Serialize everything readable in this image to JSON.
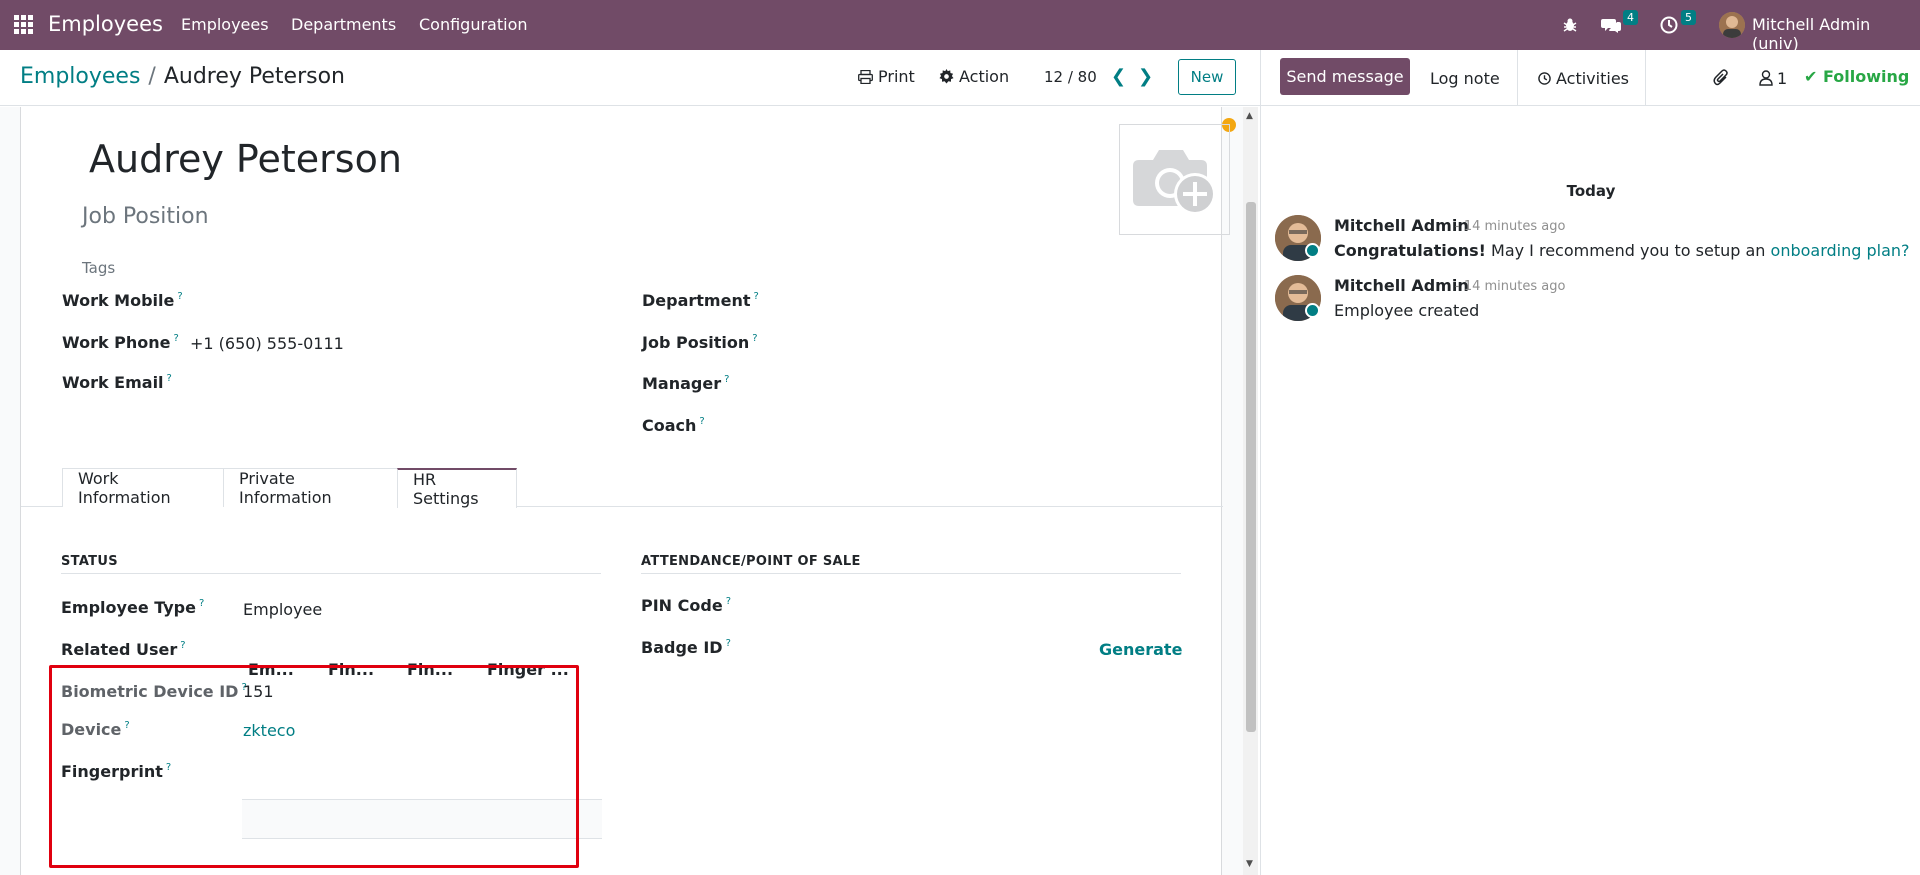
{
  "navbar": {
    "brand": "Employees",
    "menu": [
      "Employees",
      "Departments",
      "Configuration"
    ],
    "messages_count": "4",
    "activities_count": "5",
    "user": "Mitchell Admin (univ)"
  },
  "control_panel": {
    "breadcrumb_parent": "Employees",
    "breadcrumb_sep": "/",
    "breadcrumb_current": "Audrey Peterson",
    "print_label": "Print",
    "action_label": "Action",
    "pager": "12 / 80",
    "new_label": "New"
  },
  "form": {
    "name": "Audrey Peterson",
    "job_position_placeholder": "Job Position",
    "tags_placeholder": "Tags",
    "left_fields": [
      {
        "label": "Work Mobile",
        "value": ""
      },
      {
        "label": "Work Phone",
        "value": "+1 (650) 555-0111"
      },
      {
        "label": "Work Email",
        "value": ""
      }
    ],
    "right_fields": [
      {
        "label": "Department",
        "value": ""
      },
      {
        "label": "Job Position",
        "value": ""
      },
      {
        "label": "Manager",
        "value": ""
      },
      {
        "label": "Coach",
        "value": ""
      }
    ],
    "tabs": [
      "Work Information",
      "Private Information",
      "HR Settings"
    ],
    "active_tab": "HR Settings",
    "status_section": {
      "title": "STATUS",
      "employee_type_label": "Employee Type",
      "employee_type_value": "Employee",
      "related_user_label": "Related User",
      "biometric_label": "Biometric Device ID",
      "biometric_value": "151",
      "device_label": "Device",
      "device_value": "zkteco",
      "fingerprint_label": "Fingerprint",
      "fingerprint_columns": [
        "Em...",
        "Fin...",
        "Fin...",
        "Finger ..."
      ]
    },
    "attendance_section": {
      "title": "ATTENDANCE/POINT OF SALE",
      "pin_label": "PIN Code",
      "badge_label": "Badge ID",
      "generate_label": "Generate"
    },
    "help_mark": "?"
  },
  "chatter": {
    "send_message": "Send message",
    "log_note": "Log note",
    "activities": "Activities",
    "followers_count": "1",
    "following": "Following",
    "date_separator": "Today",
    "messages": [
      {
        "author": "Mitchell Admin",
        "time": "- 14 minutes ago",
        "bold_prefix": "Congratulations!",
        "body": " May I recommend you to setup an ",
        "link": "onboarding plan?"
      },
      {
        "author": "Mitchell Admin",
        "time": "- 14 minutes ago",
        "body": "Employee created"
      }
    ]
  },
  "colors": {
    "brand": "#714b67",
    "accent": "#017e84",
    "highlight_box": "#e0000f",
    "status_dot": "#f3a712",
    "following": "#28a745"
  }
}
